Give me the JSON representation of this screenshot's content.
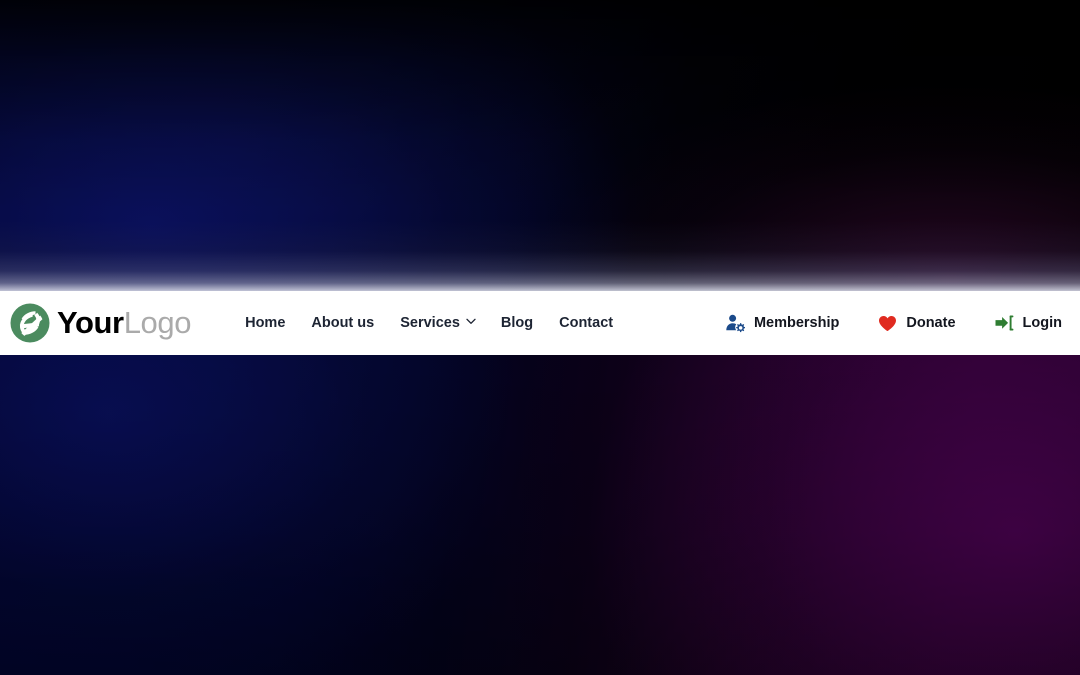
{
  "brand": {
    "name": "YourLogo",
    "name_strong": "Your",
    "name_light": "Logo",
    "logo_icon": "swirl-circle-logo-icon",
    "logo_color": "#4b8b5f"
  },
  "nav": {
    "items": [
      {
        "label": "Home",
        "has_dropdown": false
      },
      {
        "label": "About us",
        "has_dropdown": false
      },
      {
        "label": "Services",
        "has_dropdown": true,
        "dropdown_icon": "chevron-down-icon"
      },
      {
        "label": "Blog",
        "has_dropdown": false
      },
      {
        "label": "Contact",
        "has_dropdown": false
      }
    ]
  },
  "actions": [
    {
      "label": "Membership",
      "icon": "user-gear-icon",
      "icon_color": "#1b4a8a"
    },
    {
      "label": "Donate",
      "icon": "heart-icon",
      "icon_color": "#e02b20"
    },
    {
      "label": "Login",
      "icon": "sign-in-icon",
      "icon_color": "#2f7d32"
    }
  ],
  "hero": {
    "top_background_colors": [
      "#01073b",
      "#000000"
    ],
    "bottom_background_colors": [
      "#000433",
      "#330338"
    ],
    "glow_band_color": "#d0d2e1"
  },
  "navbar": {
    "background": "#ffffff",
    "text_color": "#1d2433"
  }
}
